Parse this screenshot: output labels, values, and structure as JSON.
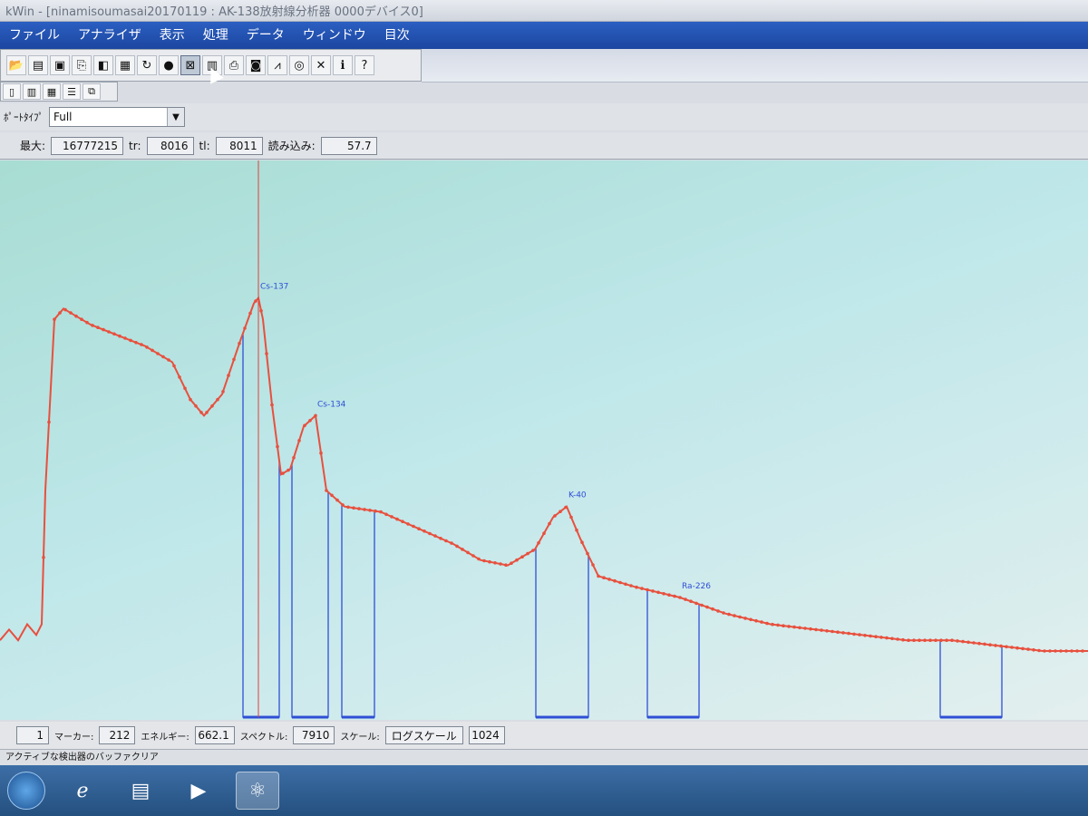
{
  "window": {
    "title": "kWin - [ninamisoumasai20170119 : AK-138放射線分析器 0000デバイス0]"
  },
  "menu": [
    "ファイル",
    "アナライザ",
    "表示",
    "処理",
    "データ",
    "ウィンドウ",
    "目次"
  ],
  "toolbar": {
    "icons": [
      "open-folder-icon",
      "open-icon",
      "save-icon",
      "copy-icon",
      "print-preview-icon",
      "grid-icon",
      "reload-icon",
      "stop-icon",
      "clear-icon",
      "document-icon",
      "printer-icon",
      "camera-icon",
      "peak-icon",
      "circle-icon",
      "delete-marker-icon",
      "info-icon",
      "help-icon"
    ],
    "icons2": [
      "layout-single-icon",
      "layout-columns-icon",
      "layout-grid-icon",
      "layout-rows-icon",
      "layout-copy-icon"
    ]
  },
  "report": {
    "label": "ﾎﾟｰﾄﾀｲﾌﾟ",
    "value": "Full"
  },
  "stats": {
    "max_label": "最大:",
    "max_value": "16777215",
    "t1_label": "tr:",
    "t1_value": "8016",
    "t2_label": "tl:",
    "t2_value": "8011",
    "read_label": "読み込み:",
    "read_value": "57.7"
  },
  "chart_data": {
    "type": "line",
    "peaks": [
      {
        "label": "Cs-137",
        "x": 285
      },
      {
        "label": "Cs-134",
        "x": 348
      },
      {
        "label": "K-40",
        "x": 625
      },
      {
        "label": "Ra-226",
        "x": 750
      }
    ],
    "marker_x": 285,
    "x": [
      0,
      10,
      20,
      30,
      40,
      46,
      50,
      60,
      70,
      80,
      100,
      130,
      160,
      190,
      210,
      225,
      245,
      265,
      280,
      285,
      290,
      300,
      310,
      320,
      335,
      348,
      360,
      380,
      420,
      460,
      500,
      530,
      560,
      590,
      610,
      625,
      640,
      660,
      700,
      750,
      800,
      850,
      900,
      950,
      1000,
      1050,
      1100,
      1150,
      1200
    ],
    "y": [
      12,
      14,
      12,
      15,
      13,
      15,
      40,
      72,
      74,
      73,
      71,
      69,
      67,
      64,
      57,
      54,
      58,
      68,
      75,
      76,
      72,
      56,
      43,
      44,
      52,
      54,
      40,
      37,
      36,
      33,
      30,
      27,
      26,
      29,
      35,
      37,
      31,
      24,
      22,
      20,
      17,
      15,
      14,
      13,
      12,
      12,
      11,
      10,
      10
    ],
    "ylim": [
      0,
      100
    ],
    "xlim": [
      0,
      1200
    ],
    "roi_regions": [
      [
        268,
        308
      ],
      [
        322,
        362
      ],
      [
        377,
        413
      ],
      [
        591,
        649
      ],
      [
        714,
        771
      ],
      [
        1037,
        1105
      ]
    ],
    "series_color": "#e8503e",
    "roi_color": "#2f4fd6"
  },
  "bottom": {
    "channel_value": "1",
    "marker_label": "マーカー:",
    "marker_value": "212",
    "energy_label": "エネルギー:",
    "energy_value": "662.1",
    "spectrum_label": "スペクトル:",
    "spectrum_value": "7910",
    "scale_label": "スケール:",
    "scale_value": "ログスケール",
    "channels_value": "1024"
  },
  "status": {
    "text": "アクティブな検出器のバッファクリア"
  }
}
